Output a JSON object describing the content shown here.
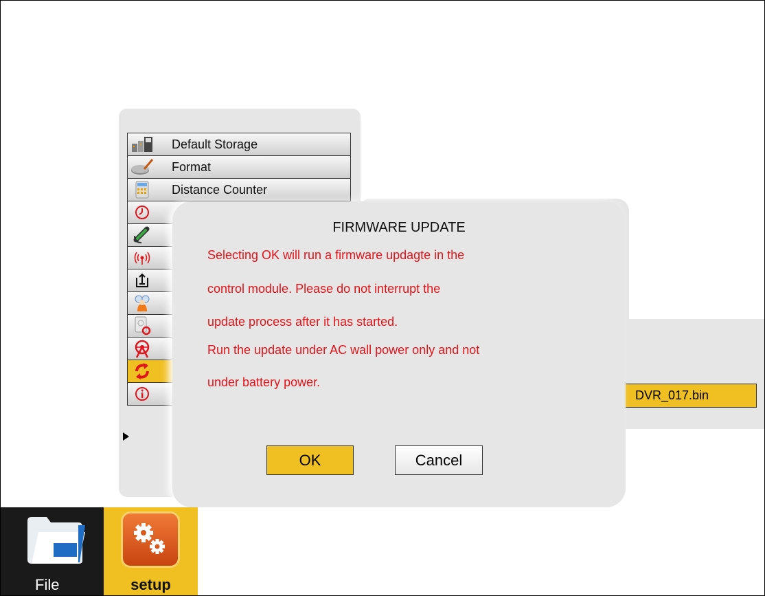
{
  "menu": {
    "items": [
      {
        "label": "Default Storage",
        "icon": "storage-icon"
      },
      {
        "label": "Format",
        "icon": "format-disk-icon"
      },
      {
        "label": "Distance Counter",
        "icon": "calculator-icon"
      },
      {
        "label": "",
        "icon": "clock-icon"
      },
      {
        "label": "",
        "icon": "cable-icon"
      },
      {
        "label": "",
        "icon": "wireless-icon"
      },
      {
        "label": "",
        "icon": "export-icon"
      },
      {
        "label": "",
        "icon": "users-icon"
      },
      {
        "label": "",
        "icon": "storage-settings-icon"
      },
      {
        "label": "",
        "icon": "reel-icon"
      },
      {
        "label": "",
        "icon": "firmware-update-icon"
      },
      {
        "label": "",
        "icon": "info-icon"
      }
    ],
    "selected_index": 10
  },
  "file_field": {
    "value": "DVR_017.bin"
  },
  "dialog": {
    "title": "FIRMWARE UPDATE",
    "lines": [
      "Selecting OK will run a firmware updagte in the",
      "control module. Please do not interrupt the",
      "update process after it has started.",
      "Run the update under AC wall power only and not",
      "under battery power."
    ],
    "ok_label": "OK",
    "cancel_label": "Cancel"
  },
  "tabs": {
    "file_label": "File",
    "setup_label": "setup"
  },
  "colors": {
    "accent_yellow": "#f0c022",
    "warning_red": "#e0141b",
    "panel_gray": "#e6e6e6"
  }
}
